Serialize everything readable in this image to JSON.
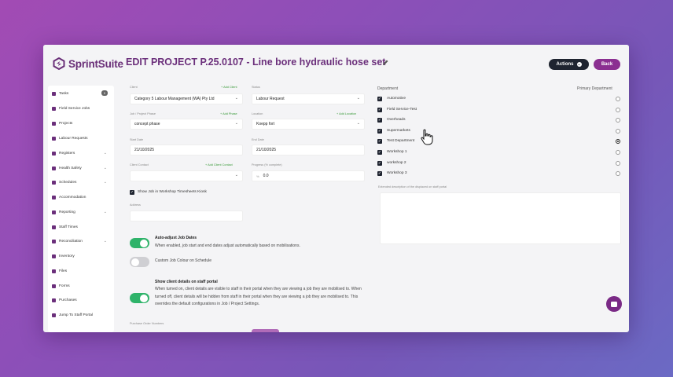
{
  "app": {
    "logo_text": "SprintSuite"
  },
  "header": {
    "title": "EDIT PROJECT P.25.0107 - Line bore hydraulic hose set",
    "actions_label": "Actions",
    "back_label": "Back"
  },
  "sidebar": {
    "items": [
      {
        "label": "Tasks",
        "badge": "0"
      },
      {
        "label": "Field Service Jobs"
      },
      {
        "label": "Projects"
      },
      {
        "label": "Labour Requests"
      },
      {
        "label": "Registers",
        "expandable": true
      },
      {
        "label": "Health Safety",
        "expandable": true
      },
      {
        "label": "Schedules",
        "expandable": true
      },
      {
        "label": "Accommodation"
      },
      {
        "label": "Reporting",
        "expandable": true
      },
      {
        "label": "Staff Times"
      },
      {
        "label": "Reconciliation",
        "expandable": true
      },
      {
        "label": "Inventory"
      },
      {
        "label": "Files"
      },
      {
        "label": "Forms"
      },
      {
        "label": "Purchases"
      },
      {
        "label": "Jump To Staff Portal"
      }
    ]
  },
  "form": {
    "client": {
      "label": "Client",
      "link": "+ Add Client",
      "value": "Category 5 Labour Management (WA) Pty Ltd"
    },
    "status": {
      "label": "Status",
      "value": "Labour Request"
    },
    "job_phase": {
      "label": "Job / Project Phase",
      "link": "+ Add Phase",
      "value": "concept phase"
    },
    "location": {
      "label": "Location",
      "link": "+ Add Location",
      "value": "Koepp fort"
    },
    "start_date": {
      "label": "Start Date",
      "value": "21/10/2025"
    },
    "end_date": {
      "label": "End Date",
      "value": "21/10/2025"
    },
    "client_contact": {
      "label": "Client Contact",
      "link": "+ Add Client Contact",
      "value": ""
    },
    "progress": {
      "label": "Progress (% complete)",
      "value": "0.0"
    },
    "kiosk_checkbox": {
      "label": "Show Job in Workshop Timesheets Kiosk",
      "checked": true
    },
    "address": {
      "label": "Address",
      "value": ""
    },
    "auto_adjust": {
      "title": "Auto-adjust Job Dates",
      "desc": "When enabled, job start and end dates adjust automatically based on mobilisations.",
      "on": true
    },
    "custom_colour": {
      "title": "Custom Job Colour on Schedule",
      "on": false
    },
    "client_details": {
      "title": "Show client details on staff portal",
      "desc": "When turned on, client details are visible to staff in their portal when they are viewing a job they are mobilised to. When turned off, client details will be hidden from staff in their portal when they are viewing a job they are mobilised to. This overrides the default configurations in Job / Project Settings.",
      "on": true
    },
    "purchase_order": {
      "label": "Purchase Order Numbers"
    }
  },
  "departments": {
    "header": "Department",
    "primary_header": "Primary Department",
    "items": [
      {
        "name": "Automotive",
        "checked": true,
        "primary": false
      },
      {
        "name": "Field Service-Test",
        "checked": true,
        "primary": false
      },
      {
        "name": "Overheads",
        "checked": true,
        "primary": false
      },
      {
        "name": "Supermarkets",
        "checked": true,
        "primary": false
      },
      {
        "name": "Test Department",
        "checked": true,
        "primary": true
      },
      {
        "name": "Workshop 1",
        "checked": true,
        "primary": false
      },
      {
        "name": "workshop 2",
        "checked": true,
        "primary": false
      },
      {
        "name": "Workshop 3",
        "checked": true,
        "primary": false
      }
    ],
    "description_label": "Extended description of the displaced on staff portal"
  },
  "colors": {
    "accent": "#6b2f7b",
    "toggle_on": "#2fb36a",
    "dark": "#1f2430",
    "back": "#8b2f91"
  }
}
